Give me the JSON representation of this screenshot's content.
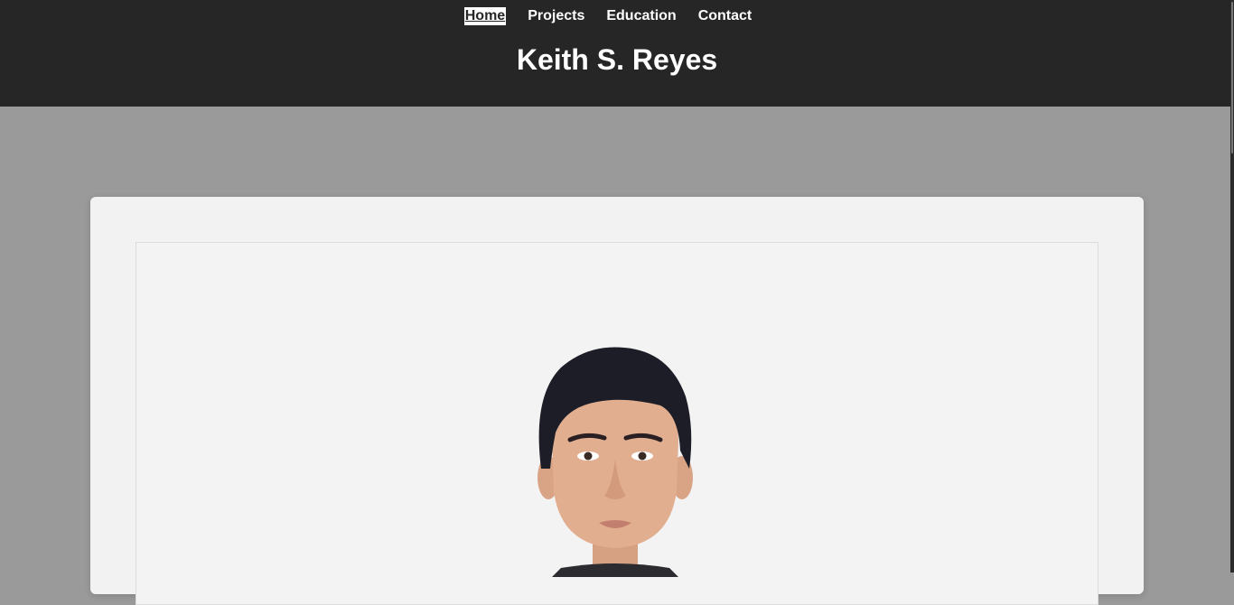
{
  "nav": {
    "items": [
      {
        "label": "Home",
        "active": true
      },
      {
        "label": "Projects",
        "active": false
      },
      {
        "label": "Education",
        "active": false
      },
      {
        "label": "Contact",
        "active": false
      }
    ]
  },
  "header": {
    "title": "Keith S. Reyes"
  },
  "colors": {
    "header_bg": "#262626",
    "page_bg": "#9a9a9a",
    "card_bg": "#f2f2f2",
    "text_light": "#ffffff"
  },
  "profile": {
    "photo_icon": "portrait-photo"
  }
}
